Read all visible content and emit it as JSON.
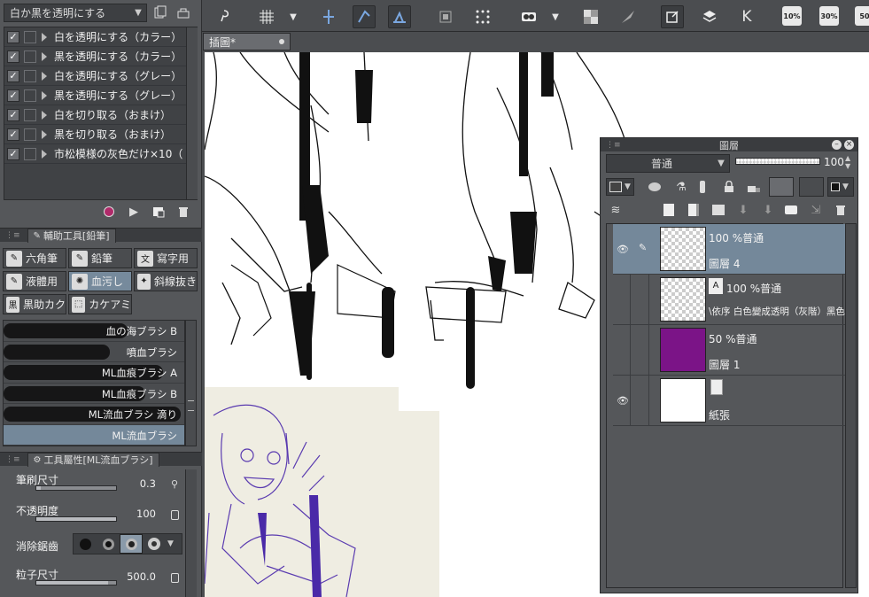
{
  "auto_actions": {
    "set_name": "白か黒を透明にする",
    "items": [
      {
        "label": "白を透明にする（カラー）",
        "checked": true
      },
      {
        "label": "黒を透明にする（カラー）",
        "checked": true
      },
      {
        "label": "白を透明にする（グレー）",
        "checked": true
      },
      {
        "label": "黒を透明にする（グレー）",
        "checked": true
      },
      {
        "label": "白を切り取る（おまけ）",
        "checked": true
      },
      {
        "label": "黒を切り取る（おまけ）",
        "checked": true
      },
      {
        "label": "市松模様の灰色だけ×10（",
        "checked": true
      }
    ],
    "check_mark": "✓"
  },
  "subtool": {
    "panel_title": "輔助工具[鉛筆]",
    "tools": [
      {
        "label": "六角筆",
        "icon": "pencil-icon"
      },
      {
        "label": "鉛筆",
        "icon": "pencil-icon"
      },
      {
        "label": "寫字用",
        "icon": "text-brush-icon"
      },
      {
        "label": "液體用",
        "icon": "liquid-icon"
      },
      {
        "label": "血污し",
        "icon": "splatter-icon",
        "selected": true
      },
      {
        "label": "斜線抜き",
        "icon": "hatch-icon"
      },
      {
        "label": "黒助カク",
        "icon": "black-ink-icon"
      },
      {
        "label": "カケアミ",
        "icon": "crosshatch-icon"
      }
    ],
    "brushes": [
      {
        "label": "血の海ブラシ B"
      },
      {
        "label": "噴血ブラシ"
      },
      {
        "label": "ML血痕ブラシ A"
      },
      {
        "label": "ML血痕ブラシ B"
      },
      {
        "label": "ML流血ブラシ 滴り"
      },
      {
        "label": "ML流血ブラシ",
        "selected": true
      }
    ]
  },
  "tool_property": {
    "panel_title": "工具屬性[ML流血ブラシ]",
    "brush_size": {
      "label": "筆刷尺寸",
      "value": "0.3",
      "fraction": 0.05
    },
    "opacity": {
      "label": "不透明度",
      "value": "100",
      "fraction": 1.0
    },
    "antialias": {
      "label": "消除鋸齒",
      "selected_index": 2
    },
    "particle_size": {
      "label": "粒子尺寸",
      "value": "500.0",
      "fraction": 0.9
    }
  },
  "toolbar": {
    "zoom_levels": [
      "10%",
      "30%",
      "50"
    ]
  },
  "document": {
    "tab_title": "插圖*"
  },
  "layers": {
    "panel_title": "圖層",
    "blend_mode": "普通",
    "opacity_value": "100",
    "items": [
      {
        "mode": "100 %普通",
        "name": "圖層 4",
        "visible": true,
        "selected": true
      },
      {
        "mode": "100 %普通",
        "name": "\\依序 白色變成透明（灰階）黑色變成",
        "visible": false,
        "selected": false
      },
      {
        "mode": "50 %普通",
        "name": "圖層 1",
        "visible": false,
        "selected": false,
        "color": "#7b1487"
      },
      {
        "mode": "",
        "name": "紙張",
        "visible": true,
        "selected": false
      }
    ]
  }
}
